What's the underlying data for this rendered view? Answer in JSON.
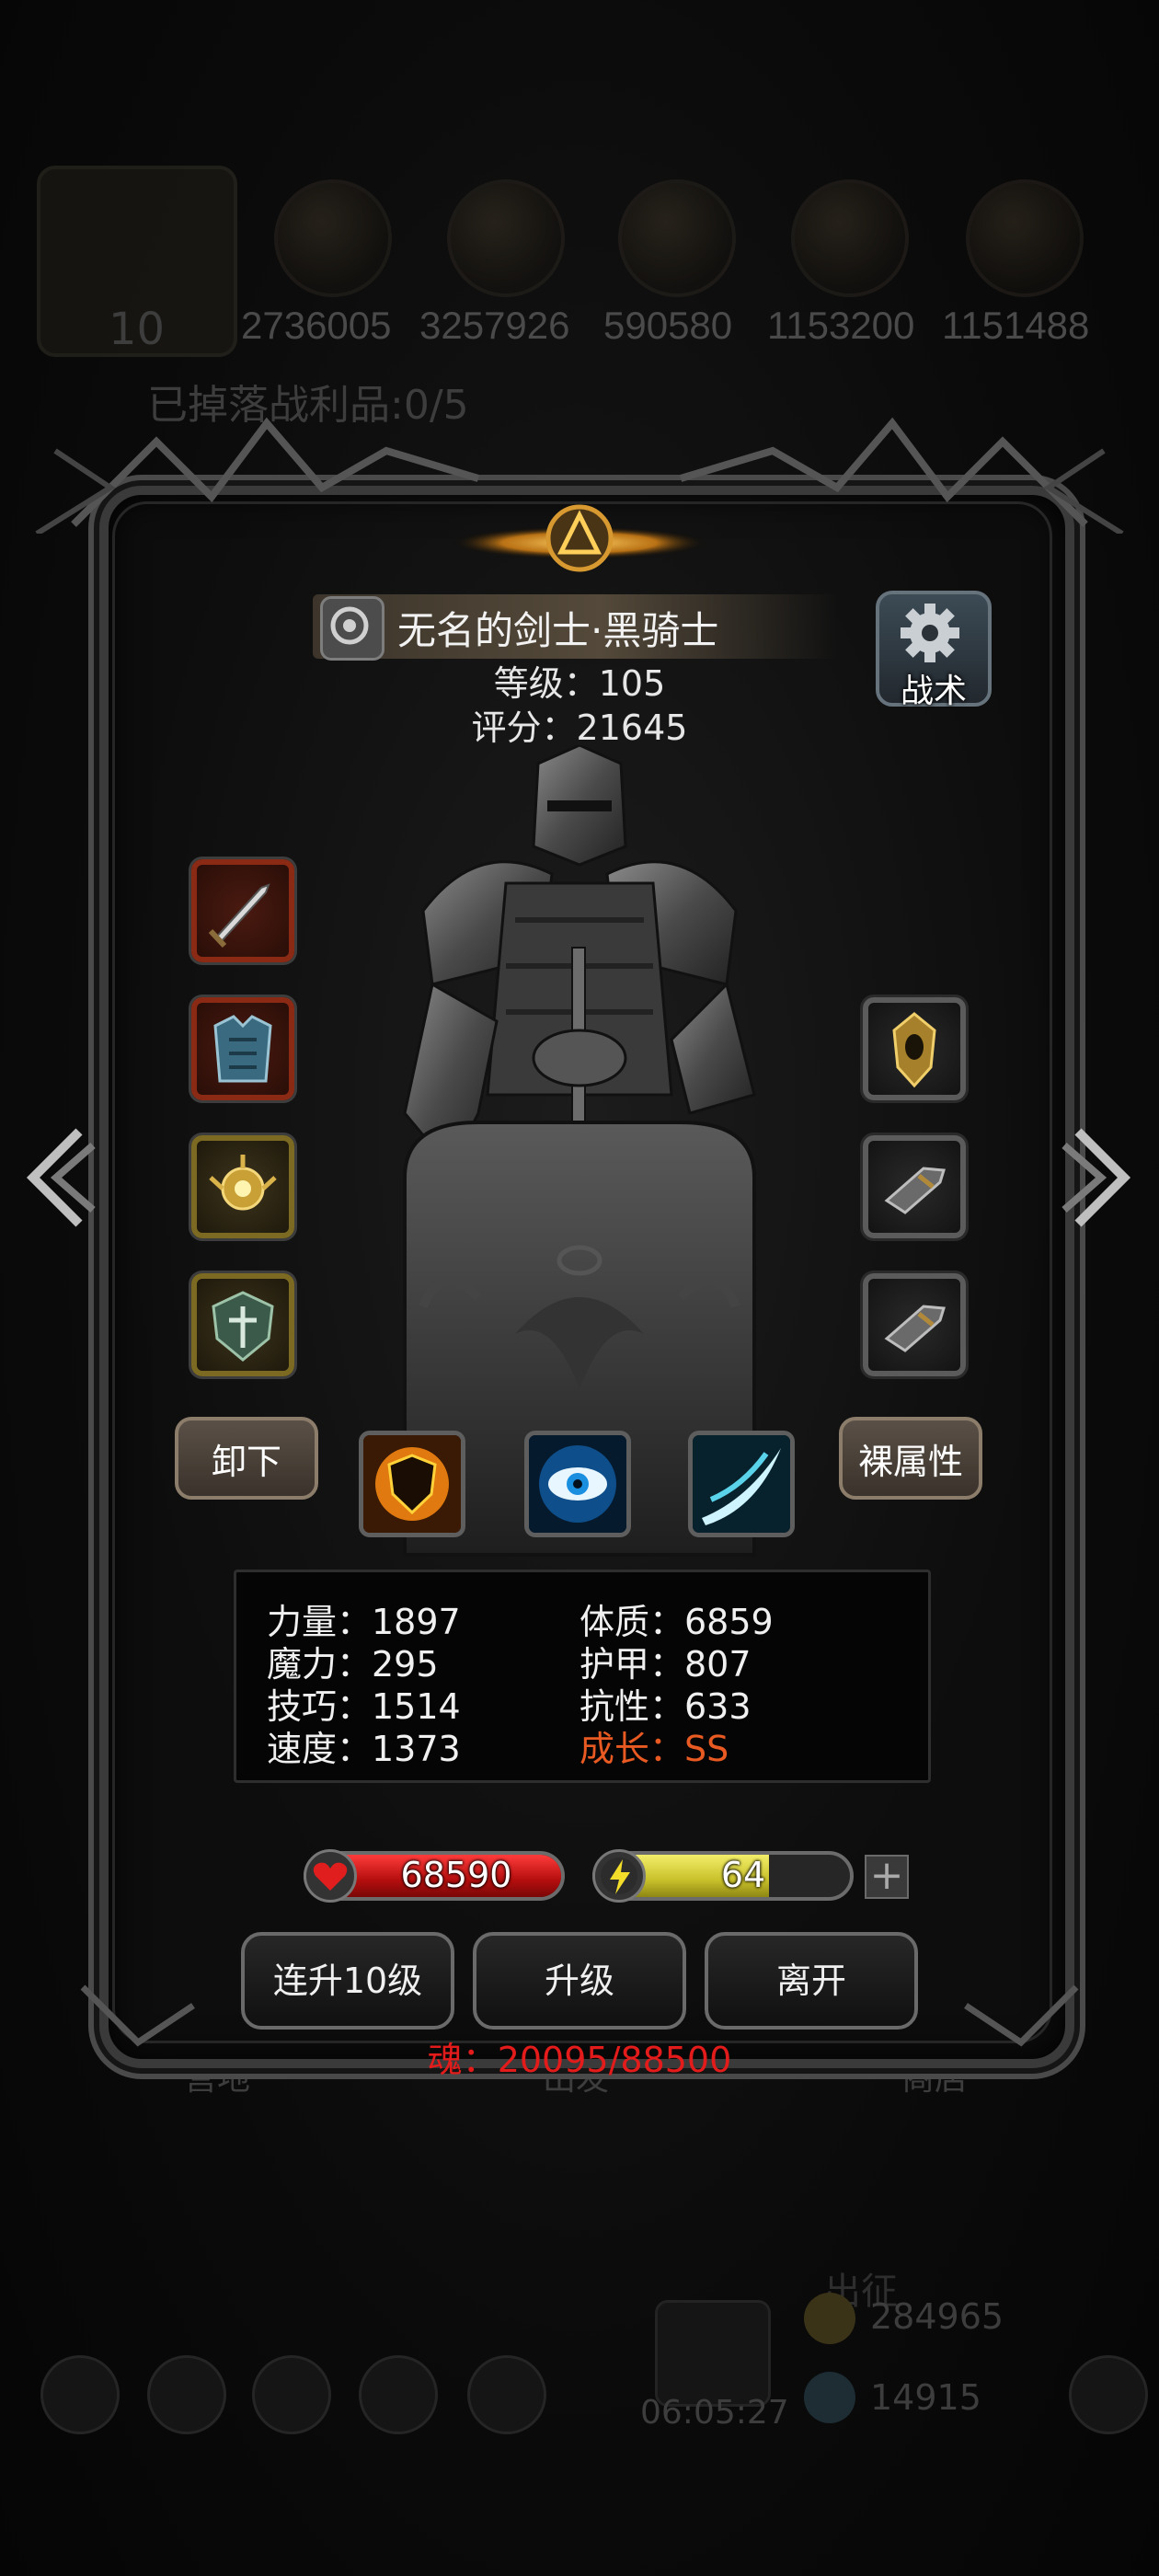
{
  "background": {
    "resource_values": [
      "2736005",
      "3257926",
      "590580",
      "1153200",
      "1151488"
    ],
    "player_level": "10",
    "drop_status": "已掉落战利品:0/5",
    "bottom_tabs": [
      "营地",
      "出发",
      "商店"
    ],
    "gold": "284965",
    "gems": "14915",
    "timer": "06:05:27",
    "side_label": "出征"
  },
  "hero": {
    "name": "无名的剑士·黑骑士",
    "level": "等级：105",
    "score": "评分：21645",
    "tactics_label": "战术"
  },
  "equipment": {
    "left_slots": [
      "greatsword-icon",
      "chest-armor-icon",
      "amulet-icon",
      "shield-emblem-icon"
    ],
    "right_slots": [
      "golden-mask-icon",
      "gauntlet-icon",
      "gauntlet-icon"
    ]
  },
  "buttons": {
    "unequip": "卸下",
    "naked_attributes": "裸属性",
    "level_up_10": "连升10级",
    "level_up": "升级",
    "leave": "离开"
  },
  "skills": [
    "fire-shield-icon",
    "blue-eye-icon",
    "slash-icon"
  ],
  "stats": {
    "strength": "力量：1897",
    "magic": "魔力：295",
    "skill": "技巧：1514",
    "speed": "速度：1373",
    "constitution": "体质：6859",
    "armor": "护甲：807",
    "resistance": "抗性：633",
    "growth": "成长：SS"
  },
  "bars": {
    "hp_value": "68590",
    "hp_fill": 1.0,
    "energy_value": "64",
    "energy_fill": 0.68,
    "plus": "+"
  },
  "soul": "魂：20095/88500",
  "colors": {
    "growth": "#e85a22",
    "soul": "#e41b1b",
    "hp": "#d11414",
    "energy": "#d8d030"
  }
}
